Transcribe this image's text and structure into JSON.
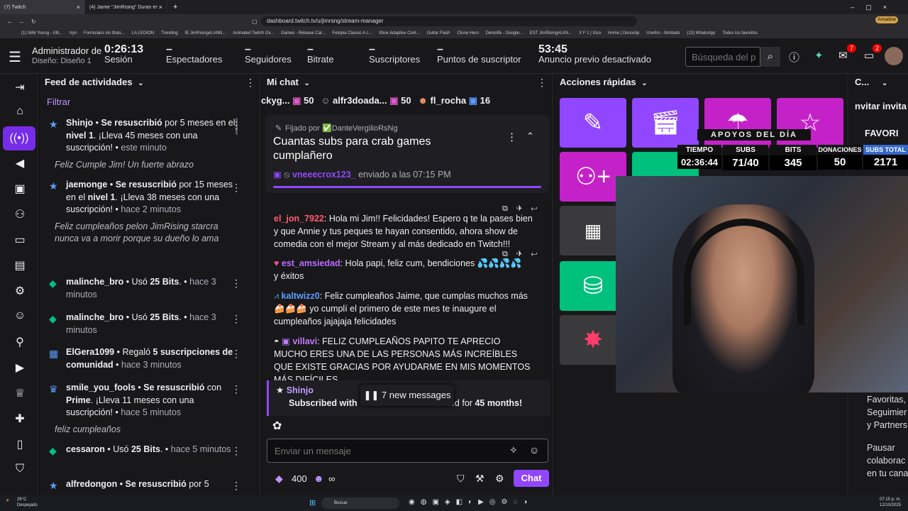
{
  "browser": {
    "tabs": [
      {
        "title": "(7) Twitch",
        "active": true
      },
      {
        "title": "(4) Jaime \"JimRising\" Duran en X: \"El...",
        "active": false
      }
    ],
    "url": "dashboard.twitch.tv/u/jimrsng/stream-manager",
    "update_label": "Actualizar",
    "bookmarks": [
      "(1) Nihil Young - Ulti...",
      "tryn",
      "Formulario sin título...",
      "LA LEGION",
      "Trending",
      "IE JimRising#LANN...",
      "Animated Twitch Ov...",
      "Games - Release Cal...",
      "Fetopia Classic A c...",
      "Xbox Adaptive Cont...",
      "Guitar Flash",
      "Clone Hero",
      "Dentolfe - Google...",
      "EST JimRising#LAN...",
      "X F 1 | Xico",
      "Home | Denoclip",
      "Unefon - Ilimitado",
      "(13) WhatsApp",
      "Todos los favoritos"
    ]
  },
  "statsbar": {
    "admin": "Administrador de",
    "design": "Diseño: Diseño 1",
    "session_time": "0:26:13",
    "session_label": "Sesión",
    "viewers_value": "–",
    "viewers_label": "Espectadores",
    "followers_value": "–",
    "followers_label": "Seguidores",
    "bitrate_value": "–",
    "bitrate_label": "Bitrate",
    "subs_value": "–",
    "subs_label": "Suscriptores",
    "points_value": "–",
    "points_label": "Puntos de suscriptor",
    "ad_time": "53:45",
    "ad_label": "Anuncio previo desactivado",
    "search_placeholder": "Búsqueda del p",
    "inbox_badge": "7",
    "whisper_badge": "2"
  },
  "feed": {
    "title": "Feed de actividades",
    "filter": "Filtrar",
    "items": [
      {
        "user": "Shinjo",
        "action": "Se resuscribió",
        "rest": "por 5 meses en el",
        "level": "nivel 1",
        "rest2": ". ¡Lleva 45 meses con una suscripción!",
        "time": "este minuto",
        "message": "Feliz Cumple Jim! Un fuerte abrazo"
      },
      {
        "user": "jaemonge",
        "action": "Se resuscribió",
        "rest": "por 15 meses en el",
        "level": "nivel 1",
        "rest2": ". ¡Lleva 38 meses con una suscripción!",
        "time": "hace 2 minutos",
        "message": "Feliz cumpleaños pelon JimRising starcra nunca va a morir porque su dueño lo ama"
      },
      {
        "user": "malinche_bro",
        "action": "Usó",
        "bits": "25 Bits",
        "time": "hace 3 minutos"
      },
      {
        "user": "malinche_bro",
        "action": "Usó",
        "bits": "25 Bits",
        "time": "hace 3 minutos"
      },
      {
        "user": "ElGera1099",
        "action": "Regaló",
        "gift": "5 suscripciones de comunidad",
        "time": "hace 3 minutos"
      },
      {
        "user": "smile_you_fools",
        "action": "Se resuscribió",
        "rest": "con",
        "prime": "Prime",
        "rest2": ". ¡Lleva 11 meses con una suscripción!",
        "time": "hace 5 minutos",
        "message": "feliz cumpleaños"
      },
      {
        "user": "cessaron",
        "action": "Usó",
        "bits": "25 Bits",
        "time": "hace 5 minutos"
      },
      {
        "user": "alfredongon",
        "action": "Se resuscribió",
        "rest": "por 5"
      }
    ]
  },
  "chat": {
    "title": "Mi chat",
    "gift_bar": [
      {
        "name": "ckyg...",
        "count": "50"
      },
      {
        "name": "alfr3doada...",
        "count": "50"
      },
      {
        "name": "fl_rocha",
        "count": "16"
      }
    ],
    "pinned_by_label": "Fijado por",
    "pinned_by": "DanteVergilioRsNg",
    "pinned_text": "Cuantas subs para crab games cumplañero",
    "pinned_user": "vneeecrox123_",
    "pinned_sent": "enviado a las 07:15 PM",
    "messages": [
      {
        "user": "el_jon_7922",
        "color": "#ff5b6e",
        "text": "Hola mi Jim!! Felicidades! Espero q te la pases bien y que Annie y tus peques te hayan consentido, ahora show de comedia con el mejor Stream y al más dedicado en Twitch!!!"
      },
      {
        "user": "est_amsiedad",
        "color": "#b96bff",
        "text": "Hola papi, feliz cum, bendiciones",
        "text2": "y éxitos"
      },
      {
        "user": "kaltwizz0",
        "color": "#5c9dff",
        "text": "Feliz cumpleaños Jaime, que cumplas muchos más",
        "text2": "yo cumplí el primero de este mes te inaugure el cumpleaños jajajaja felicidades"
      },
      {
        "user": "villavi",
        "color": "#c47bff",
        "text": "FELIZ CUMPLEAÑOS PAPITO TE APRECIO MUCHO ERES UNA DE LAS PERSONAS MÁS INCREÍBLES QUE EXISTE GRACIAS POR AYUDARME EN MIS MOMENTOS MÁS DIFÍCILES"
      }
    ],
    "sub_user": "Shinjo",
    "sub_text_a": "Subscribed with",
    "sub_text_b": "bed for",
    "sub_months": "45 months!",
    "new_messages": "7 new messages",
    "input_placeholder": "Enviar un mensaje",
    "points": "400",
    "infinity": "∞",
    "chat_button": "Chat"
  },
  "quick": {
    "title": "Acciones rápidas",
    "colors": {
      "purple": "#9147ff",
      "magenta": "#c422c8",
      "green": "#00c07d",
      "gray": "#3a3a3d"
    }
  },
  "right": {
    "title": "C...",
    "invite": "nvitar invita",
    "favs": "FAVORI",
    "fav_text": "Favoritas, Seguimier y Partners",
    "pause_text": "Pausar colaborac en tu cana"
  },
  "overlay": {
    "title": "APOYOS DEL DÍA",
    "cols": [
      {
        "h": "TIEMPO",
        "v": "02:36:44"
      },
      {
        "h": "SUBS",
        "v": "71/40"
      },
      {
        "h": "BITS",
        "v": "345"
      },
      {
        "h": "DONACIONES",
        "v": "50"
      },
      {
        "h": "SUBS TOTAL",
        "v": "2171"
      }
    ]
  },
  "taskbar": {
    "weather_temp": "26°C",
    "weather_desc": "Despejado",
    "search": "Buscar",
    "time": "07:15 p. m.",
    "date": "12/10/2025"
  }
}
